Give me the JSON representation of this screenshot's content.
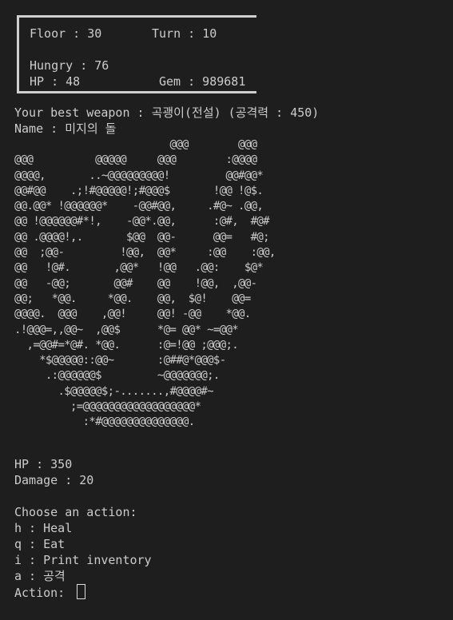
{
  "status": {
    "floor": "Floor : 30",
    "turn": "Turn : 10",
    "hungry": "Hungry : 76",
    "hp": "HP : 48",
    "gem": "Gem : 989681"
  },
  "weapon_line": "Your best weapon : 곡괭이(전설) (공격력 : 450)",
  "name_line": "Name : 미지의 돌",
  "monster_art": [
    "                         @@@        @@@",
    "@@@          @@@@@     @@@        :@@@@",
    "@@@@,       ..~@@@@@@@@@!         @@#@@*",
    "@@#@@    .;!#@@@@@!;#@@@$       !@@ !@$.",
    "@@.@@* !@@@@@@*    -@@#@@,     .#@~ .@@,",
    "@@ !@@@@@@#*!,    -@@*.@@,      :@#,  #@#",
    "@@ .@@@@!,.       $@@  @@-      @@=   #@;",
    "@@  ;@@-         !@@,  @@*     :@@    :@@,",
    "@@   !@#.       ,@@*   !@@   .@@:    $@*",
    "@@   -@@;       @@#    @@    !@@,  ,@@-",
    "@@;   *@@.     *@@.    @@,  $@!    @@=",
    "@@@@.  @@@    ,@@!     @@! -@@    *@@.",
    ".!@@@=,,@@~  ,@@$      *@= @@* ~=@@*",
    "  ,=@@#=*@#. *@@.      :@=!@@ ;@@@;.",
    "    *$@@@@@::@@~       :@##@*@@@$-",
    "     .:@@@@@@$         ~@@@@@@@;.",
    "       .$@@@@@$;-.......,#@@@@#~",
    "         ;=@@@@@@@@@@@@@@@@@@*",
    "           :*#@@@@@@@@@@@@@@."
  ],
  "stats": {
    "hp": "HP : 350",
    "damage": "Damage : 20"
  },
  "actions": {
    "prompt": "Choose an action:",
    "items": [
      "h : Heal",
      "q : Eat",
      "i : Print inventory",
      "a : 공격"
    ],
    "input_label": "Action: "
  }
}
